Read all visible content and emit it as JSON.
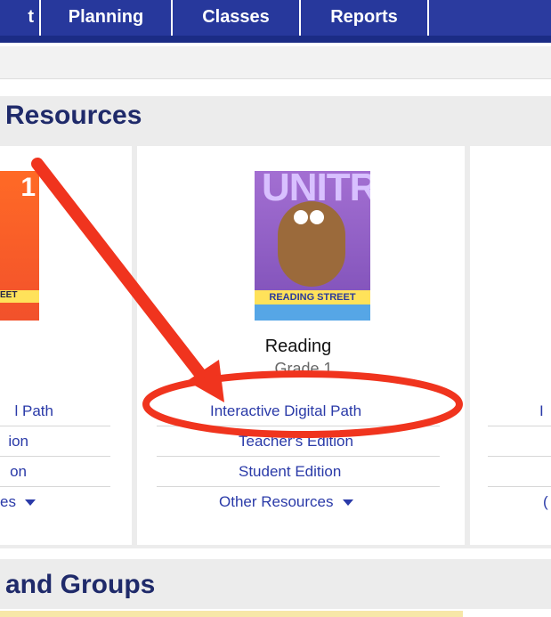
{
  "nav": {
    "partial_tab": "t",
    "tabs": [
      "Planning",
      "Classes",
      "Reports"
    ]
  },
  "resources": {
    "title": "Resources",
    "left_book": {
      "cover_number": "1",
      "cover_strip": "EET",
      "links": [
        "l Path",
        "ion",
        "on",
        "es"
      ]
    },
    "center_book": {
      "cover_unit": "UNITR",
      "cover_strip": "READING STREET",
      "title": "Reading",
      "subtitle": "Grade 1",
      "links": [
        "Interactive Digital Path",
        "Teacher's Edition",
        "Student Edition",
        "Other Resources"
      ]
    },
    "right_book": {
      "links": [
        "I",
        "("
      ]
    }
  },
  "groups": {
    "title": "and Groups"
  },
  "annotation_colors": {
    "arrow": "#f0341e",
    "oval": "#f0341e"
  }
}
